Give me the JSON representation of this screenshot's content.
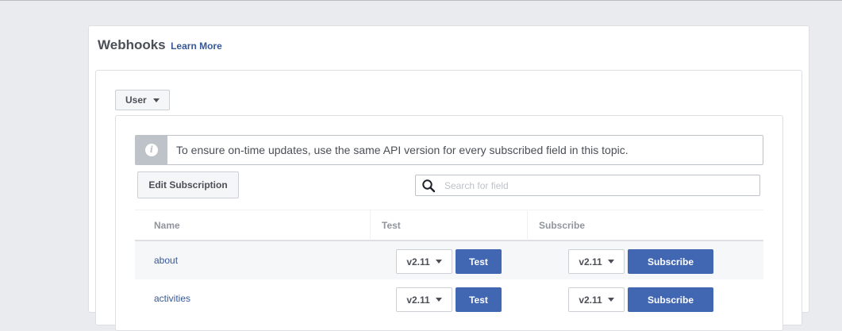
{
  "panel": {
    "title": "Webhooks",
    "learn_more": "Learn More"
  },
  "topic_select": {
    "value": "User"
  },
  "notice": {
    "icon": "info-icon",
    "text": "To ensure on-time updates, use the same API version for every subscribed field in this topic."
  },
  "toolbar": {
    "edit_label": "Edit Subscription",
    "search_placeholder": "Search for field",
    "search_value": ""
  },
  "table": {
    "headers": {
      "name": "Name",
      "test": "Test",
      "subscribe": "Subscribe"
    },
    "rows": [
      {
        "name": "about",
        "test_version": "v2.11",
        "test_label": "Test",
        "subscribe_version": "v2.11",
        "subscribe_label": "Subscribe"
      },
      {
        "name": "activities",
        "test_version": "v2.11",
        "test_label": "Test",
        "subscribe_version": "v2.11",
        "subscribe_label": "Subscribe"
      }
    ]
  },
  "colors": {
    "page_bg": "#e9ebee",
    "primary_button": "#4267b2",
    "link": "#365899",
    "muted_header": "#90949c"
  }
}
